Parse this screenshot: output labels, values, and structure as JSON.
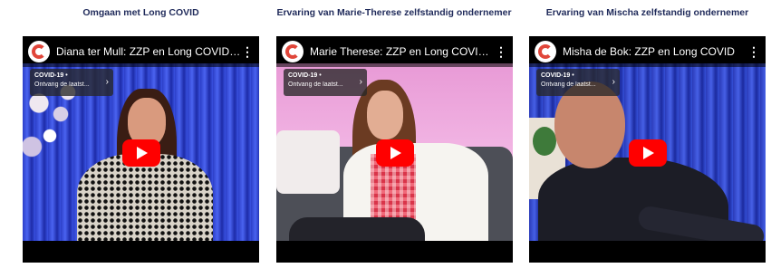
{
  "sections": [
    {
      "heading": "Omgaan met Long COVID",
      "video": {
        "title": "Diana ter Mull: ZZP en Long COVID ...",
        "playlist_line1": "COVID-19 •",
        "playlist_line2": "Ontvang de laatst..."
      }
    },
    {
      "heading": "Ervaring van Marie-Therese zelfstandig ondernemer",
      "video": {
        "title": "Marie Therese: ZZP en Long COVID ...",
        "playlist_line1": "COVID-19 •",
        "playlist_line2": "Ontvang de laatst..."
      }
    },
    {
      "heading": "Ervaring van Mischa zelfstandig ondernemer",
      "video": {
        "title": "Misha de Bok: ZZP en Long COVID",
        "playlist_line1": "COVID-19 •",
        "playlist_line2": "Ontvang de laatst..."
      }
    }
  ],
  "icons": {
    "channel_logo": "channel-logo-icon",
    "menu": "kebab-menu-icon",
    "chevron": "chevron-right-icon",
    "play": "youtube-play-icon"
  },
  "colors": {
    "heading": "#1f2a5a",
    "play_button": "#ff0000",
    "logo_accent": "#e0463a"
  }
}
